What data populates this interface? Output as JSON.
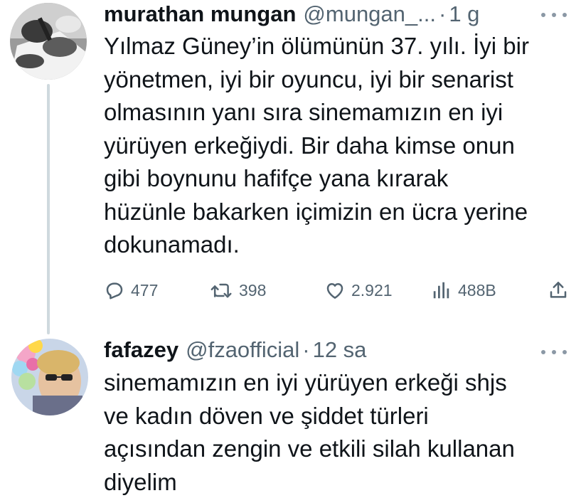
{
  "tweets": [
    {
      "author_name": "murathan mungan",
      "handle": "@mungan_...",
      "separator": "·",
      "time": "1 g",
      "text_lines": [
        "Yılmaz Güney’in ölümünün 37.  yılı. İyi bir",
        "yönetmen, iyi bir oyuncu, iyi bir senarist",
        "olmasının yanı sıra sinemamızın en iyi",
        "yürüyen erkeğiydi. Bir daha kimse onun",
        "gibi boynunu hafifçe yana kırarak",
        "hüzünle bakarken içimizin en ücra yerine",
        "dokunamadı."
      ],
      "stats": {
        "replies": "477",
        "retweets": "398",
        "likes": "2.921",
        "views": "488B"
      },
      "icons": [
        "reply-icon",
        "retweet-icon",
        "like-icon",
        "views-icon",
        "share-icon",
        "more-icon"
      ]
    },
    {
      "author_name": "fafazey",
      "handle": "@fzaofficial",
      "separator": "·",
      "time": "12 sa",
      "text_lines": [
        "sinemamızın en iyi yürüyen erkeği shjs",
        "ve kadın döven ve şiddet türleri",
        "açısından zengin ve etkili silah kullanan",
        "diyelim"
      ],
      "icons": [
        "more-icon"
      ]
    }
  ],
  "colors": {
    "text": "#0f1419",
    "secondary": "#536471",
    "thread_line": "#cfd9de"
  }
}
